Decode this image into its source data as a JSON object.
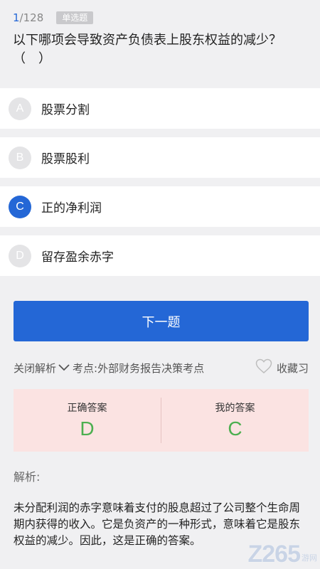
{
  "header": {
    "progress_current": "1",
    "progress_total": "/128",
    "question_type": "单选题",
    "question": "以下哪项会导致资产负债表上股东权益的减少？（　）"
  },
  "options": [
    {
      "letter": "A",
      "text": "股票分割",
      "selected": false
    },
    {
      "letter": "B",
      "text": "股票股利",
      "selected": false
    },
    {
      "letter": "C",
      "text": "正的净利润",
      "selected": true
    },
    {
      "letter": "D",
      "text": "留存盈余赤字",
      "selected": false
    }
  ],
  "next_button": "下一题",
  "analysis_bar": {
    "toggle_label": "关闭解析",
    "point": "考点:外部财务报告决策考点",
    "favorite_label": "收藏习"
  },
  "answer": {
    "correct_label": "正确答案",
    "correct_value": "D",
    "mine_label": "我的答案",
    "mine_value": "C"
  },
  "explanation": {
    "title": "解析:",
    "body": "未分配利润的赤字意味着支付的股息超过了公司整个生命周期内获得的收入。它是负资产的一种形式，意味着它是股东权益的减少。因此，这是正确的答案。"
  },
  "watermark": {
    "logo": "Z265",
    "sub": "游网"
  },
  "colors": {
    "accent": "#2467d6",
    "answer_bg": "#fbe3e2",
    "answer_text": "#4caf50"
  }
}
